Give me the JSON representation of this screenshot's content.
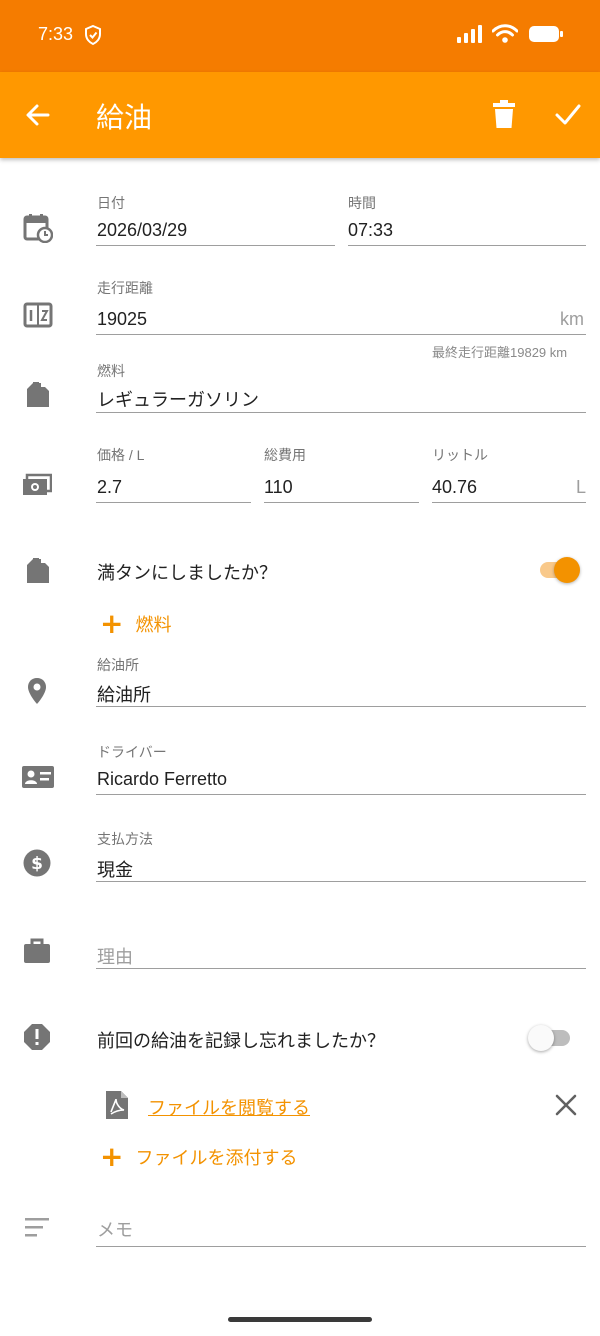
{
  "status": {
    "time": "7:33"
  },
  "appbar": {
    "title": "給油"
  },
  "date": {
    "label": "日付",
    "value": "2026/03/29"
  },
  "time": {
    "label": "時間",
    "value": "07:33"
  },
  "odometer": {
    "label": "走行距離",
    "value": "19025",
    "unit": "km",
    "hint": "最終走行距離19829 km"
  },
  "fuel": {
    "label": "燃料",
    "value": "レギュラーガソリン"
  },
  "price": {
    "label": "価格 / L",
    "value": "2.7"
  },
  "total": {
    "label": "総費用",
    "value": "110"
  },
  "liters": {
    "label": "リットル",
    "value": "40.76",
    "unit": "L"
  },
  "full_tank": {
    "label": "満タンにしましたか？",
    "checked": true
  },
  "add_fuel": {
    "label": "燃料"
  },
  "station": {
    "label": "給油所",
    "value": "給油所"
  },
  "driver": {
    "label": "ドライバー",
    "value": "Ricardo Ferretto"
  },
  "payment": {
    "label": "支払方法",
    "value": "現金"
  },
  "reason": {
    "placeholder": "理由"
  },
  "missed": {
    "label": "前回の給油を記録し忘れましたか？",
    "checked": false
  },
  "file": {
    "view_label": "ファイルを閲覧する",
    "attach_label": "ファイルを添付する"
  },
  "memo": {
    "placeholder": "メモ"
  },
  "colors": {
    "primary": "#ff9800",
    "primary_dark": "#f57c00",
    "accent": "#f39200",
    "icon_grey": "#757575"
  },
  "icons": [
    "back-arrow-icon",
    "trash-icon",
    "check-icon",
    "calendar-clock-icon",
    "odometer-icon",
    "fuel-can-icon",
    "cash-icon",
    "location-pin-icon",
    "id-card-icon",
    "dollar-icon",
    "briefcase-icon",
    "alert-octagon-icon",
    "pdf-file-icon",
    "close-icon",
    "notes-icon"
  ]
}
